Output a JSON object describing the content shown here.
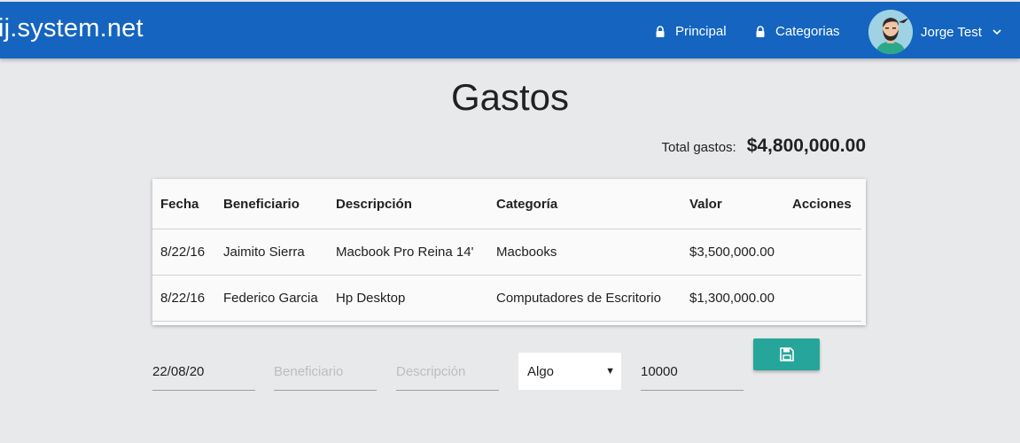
{
  "navbar": {
    "brand": "ij.system.net",
    "links": [
      {
        "label": "Principal",
        "icon": "lock-icon"
      },
      {
        "label": "Categorias",
        "icon": "lock-icon"
      }
    ],
    "user_name": "Jorge Test",
    "color": "#1565c0"
  },
  "page": {
    "title": "Gastos",
    "total_label": "Total gastos:",
    "total_value": "$4,800,000.00"
  },
  "table": {
    "headers": [
      "Fecha",
      "Beneficiario",
      "Descripción",
      "Categoría",
      "Valor",
      "Acciones"
    ],
    "rows": [
      [
        "8/22/16",
        "Jaimito Sierra",
        "Macbook Pro Reina 14'",
        "Macbooks",
        "$3,500,000.00",
        ""
      ],
      [
        "8/22/16",
        "Federico Garcia",
        "Hp Desktop",
        "Computadores de Escritorio",
        "$1,300,000.00",
        ""
      ]
    ]
  },
  "form": {
    "fecha_value": "22/08/20",
    "beneficiario_placeholder": "Beneficiario",
    "descripcion_placeholder": "Descripción",
    "categoria_selected": "Algo",
    "valor_value": "10000",
    "save_icon": "floppy-disk-icon",
    "save_color": "#26a69a"
  }
}
